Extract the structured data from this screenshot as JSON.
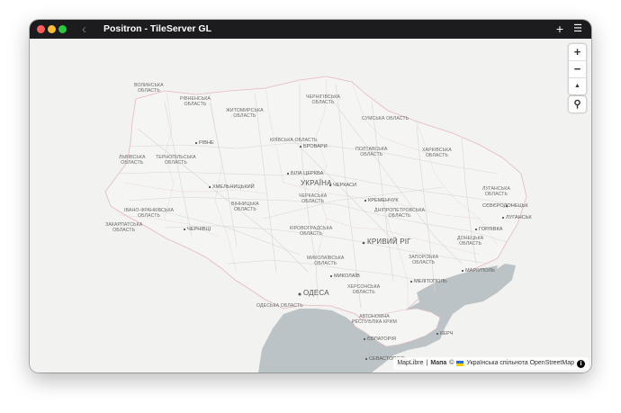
{
  "window": {
    "title": "Positron - TileServer GL",
    "back_icon": "‹",
    "add_icon": "+",
    "menu_icon": "☰"
  },
  "controls": {
    "zoom_in": "+",
    "zoom_out": "−",
    "compass": "▲",
    "inspect_icon": "⚲"
  },
  "attribution": {
    "maplibre": "MapLibre",
    "separator": " | ",
    "map_label": "Мапа",
    "copyright": " © ",
    "community": "Українська спільнота OpenStreetMap"
  },
  "regions": [
    {
      "id": "volyn",
      "line1": "ВОЛИНСЬКА",
      "line2": "ОБЛАСТЬ"
    },
    {
      "id": "rivne",
      "line1": "РІВНЕНСЬКА",
      "line2": "ОБЛАСТЬ"
    },
    {
      "id": "zhytomyr",
      "line1": "ЖИТОМИРСЬКА",
      "line2": "ОБЛАСТЬ"
    },
    {
      "id": "chernihiv",
      "line1": "ЧЕРНІГІВСЬКА",
      "line2": "ОБЛАСТЬ"
    },
    {
      "id": "sumy",
      "line1": "СУМСЬКА ОБЛАСТЬ",
      "line2": ""
    },
    {
      "id": "kyiv",
      "line1": "КИЇВСЬКА ОБЛАСТЬ",
      "line2": ""
    },
    {
      "id": "lviv",
      "line1": "ЛЬВІВСЬКА",
      "line2": "ОБЛАСТЬ"
    },
    {
      "id": "ternopil",
      "line1": "ТЕРНОПІЛЬСЬКА",
      "line2": "ОБЛАСТЬ"
    },
    {
      "id": "poltava",
      "line1": "ПОЛТАВСЬКА",
      "line2": "ОБЛАСТЬ"
    },
    {
      "id": "kharkiv",
      "line1": "ХАРКІВСЬКА",
      "line2": "ОБЛАСТЬ"
    },
    {
      "id": "cherkasy",
      "line1": "ЧЕРКАСЬКА",
      "line2": "ОБЛАСТЬ"
    },
    {
      "id": "vinnytsia",
      "line1": "ВІННИЦЬКА",
      "line2": "ОБЛАСТЬ"
    },
    {
      "id": "ivano",
      "line1": "ІВАНО-ФРАНКІВСЬКА",
      "line2": "ОБЛАСТЬ"
    },
    {
      "id": "zakarpattia",
      "line1": "ЗАКАРПАТСЬКА",
      "line2": "ОБЛАСТЬ"
    },
    {
      "id": "luhansk",
      "line1": "ЛУГАНСЬКА",
      "line2": "ОБЛАСТЬ"
    },
    {
      "id": "dnipro",
      "line1": "ДНІПРОПЕТРОВСЬКА",
      "line2": "ОБЛАСТЬ"
    },
    {
      "id": "kirovohrad",
      "line1": "КІРОВОГРАДСЬКА",
      "line2": "ОБЛАСТЬ"
    },
    {
      "id": "donetsk",
      "line1": "ДОНЕЦЬКА",
      "line2": "ОБЛАСТЬ"
    },
    {
      "id": "zaporizhzhia",
      "line1": "ЗАПОРІЗЬКА",
      "line2": "ОБЛАСТЬ"
    },
    {
      "id": "mykolaiv",
      "line1": "МИКОЛАЇВСЬКА",
      "line2": "ОБЛАСТЬ"
    },
    {
      "id": "kherson",
      "line1": "ХЕРСОНСЬКА",
      "line2": "ОБЛАСТЬ"
    },
    {
      "id": "odesa",
      "line1": "ОДЕСЬКА ОБЛАСТЬ",
      "line2": ""
    },
    {
      "id": "crimea",
      "line1": "АВТОНОМНА",
      "line2": "РЕСПУБЛІКА КРИМ"
    }
  ],
  "country_label": "УКРАЇНА",
  "cities": [
    {
      "id": "rivne",
      "name": "РІВНЕ"
    },
    {
      "id": "brovary",
      "name": "БРОВАРИ"
    },
    {
      "id": "bila",
      "name": "БІЛА ЦЕРКВА"
    },
    {
      "id": "cherkasy",
      "name": "ЧЕРКАСИ"
    },
    {
      "id": "khmelnytskyi",
      "name": "ХМЕЛЬНИЦЬКИЙ"
    },
    {
      "id": "kremenchuk",
      "name": "КРЕМЕНЧУК"
    },
    {
      "id": "siverskodonetsk",
      "name": "СЄВЄРОДОНЕЦЬК"
    },
    {
      "id": "luhansk",
      "name": "ЛУГАНСЬК"
    },
    {
      "id": "chernivtsi",
      "name": "ЧЕРНІВЦІ"
    },
    {
      "id": "horlivka",
      "name": "ГОРЛІВКА"
    },
    {
      "id": "kryvyi",
      "name": "КРИВИЙ РІГ"
    },
    {
      "id": "mariupol",
      "name": "МАРІУПОЛЬ"
    },
    {
      "id": "mykolaiv",
      "name": "МИКОЛАЇВ"
    },
    {
      "id": "melitopol",
      "name": "МЕЛІТОПОЛЬ"
    },
    {
      "id": "odesa",
      "name": "ОДЕСА"
    },
    {
      "id": "kerch",
      "name": "КЕРЧ"
    },
    {
      "id": "yevpatoria",
      "name": "ЄВПАТОРІЯ"
    },
    {
      "id": "sevastopol",
      "name": "СЕВАСТОПОЛЬ"
    }
  ],
  "colors": {
    "land": "#f2f2f0",
    "water": "#bcc3c6",
    "roads": "#d9d9d9",
    "border": "#e6b8c0",
    "titlebar": "#1c1c1e"
  }
}
